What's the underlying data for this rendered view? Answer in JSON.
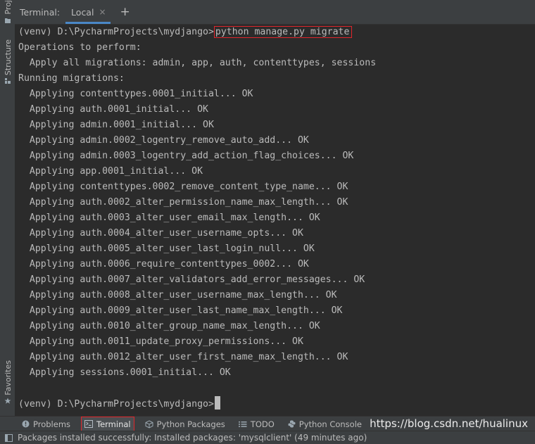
{
  "left_strip": {
    "project_label": "Proj",
    "structure_label": "Structure",
    "favorites_label": "Favorites"
  },
  "tabbar": {
    "caption": "Terminal:",
    "active_tab": "Local",
    "close_glyph": "×",
    "add_glyph": "+"
  },
  "terminal": {
    "prompt": "(venv) D:\\PycharmProjects\\mydjango>",
    "command": "python manage.py migrate",
    "output": [
      "Operations to perform:",
      "  Apply all migrations: admin, app, auth, contenttypes, sessions",
      "Running migrations:",
      "  Applying contenttypes.0001_initial... OK",
      "  Applying auth.0001_initial... OK",
      "  Applying admin.0001_initial... OK",
      "  Applying admin.0002_logentry_remove_auto_add... OK",
      "  Applying admin.0003_logentry_add_action_flag_choices... OK",
      "  Applying app.0001_initial... OK",
      "  Applying contenttypes.0002_remove_content_type_name... OK",
      "  Applying auth.0002_alter_permission_name_max_length... OK",
      "  Applying auth.0003_alter_user_email_max_length... OK",
      "  Applying auth.0004_alter_user_username_opts... OK",
      "  Applying auth.0005_alter_user_last_login_null... OK",
      "  Applying auth.0006_require_contenttypes_0002... OK",
      "  Applying auth.0007_alter_validators_add_error_messages... OK",
      "  Applying auth.0008_alter_user_username_max_length... OK",
      "  Applying auth.0009_alter_user_last_name_max_length... OK",
      "  Applying auth.0010_alter_group_name_max_length... OK",
      "  Applying auth.0011_update_proxy_permissions... OK",
      "  Applying auth.0012_alter_user_first_name_max_length... OK",
      "  Applying sessions.0001_initial... OK",
      ""
    ],
    "final_prompt": "(venv) D:\\PycharmProjects\\mydjango>"
  },
  "toolbar": {
    "items": [
      {
        "label": "Problems",
        "icon": "problems-icon",
        "active": false
      },
      {
        "label": "Terminal",
        "icon": "terminal-icon",
        "active": true
      },
      {
        "label": "Python Packages",
        "icon": "packages-icon",
        "active": false
      },
      {
        "label": "TODO",
        "icon": "todo-icon",
        "active": false
      },
      {
        "label": "Python Console",
        "icon": "python-icon",
        "active": false
      }
    ],
    "watermark": "https://blog.csdn.net/hualinux"
  },
  "statusbar": {
    "message": "Packages installed successfully: Installed packages: 'mysqlclient' (49 minutes ago)"
  },
  "colors": {
    "background": "#2b2b2b",
    "panel": "#3c3f41",
    "text": "#bbbbbb",
    "highlight_border": "#e0252b",
    "tab_underline": "#4a88c7"
  }
}
